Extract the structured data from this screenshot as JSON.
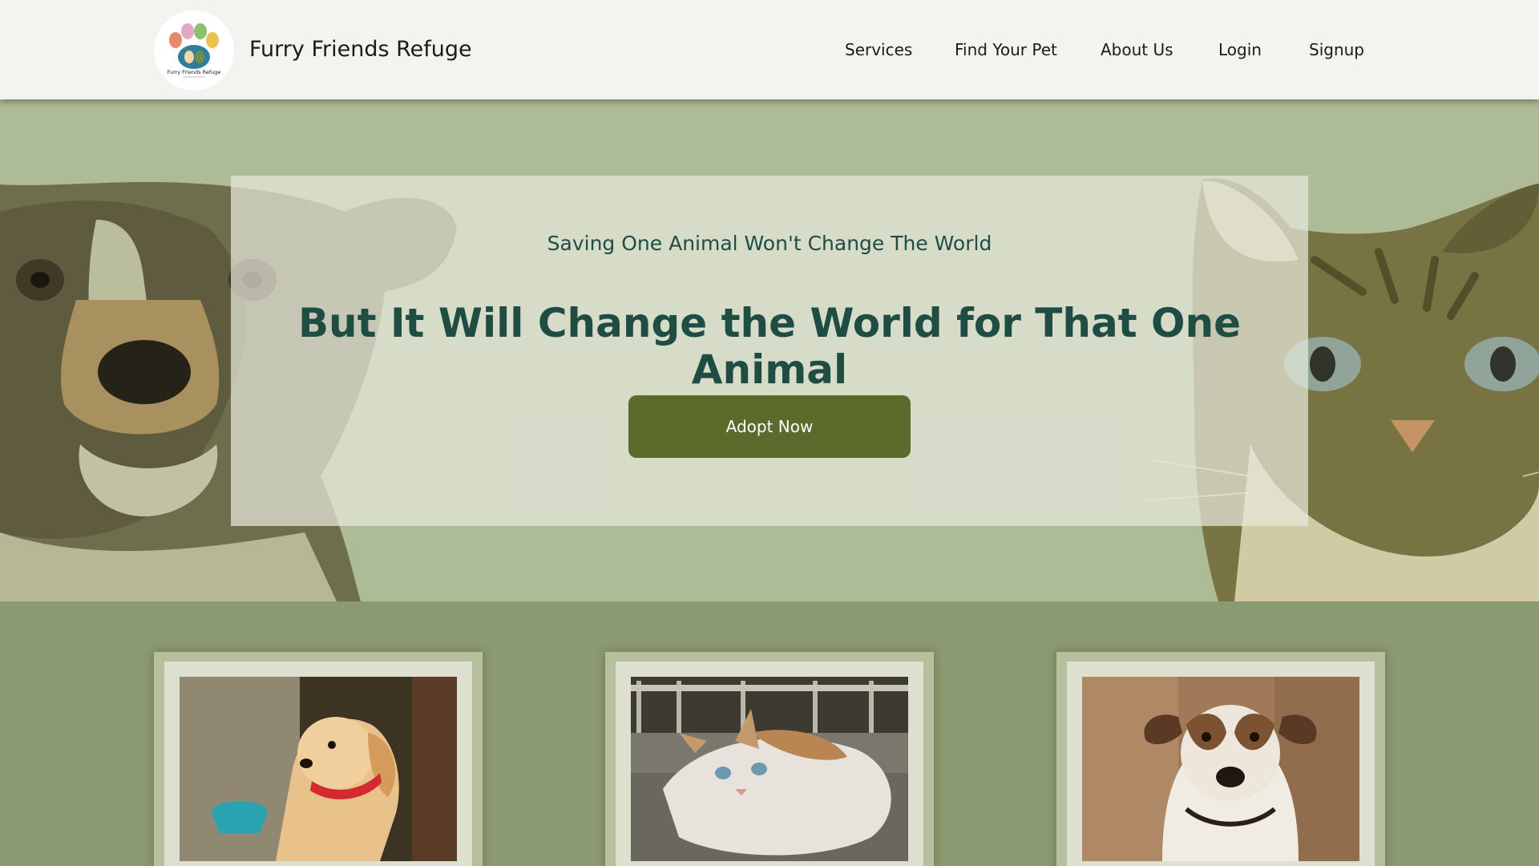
{
  "header": {
    "brand": "Furry Friends Refuge",
    "logo_text": "Furry Friends Refuge",
    "nav": [
      {
        "label": "Services"
      },
      {
        "label": "Find Your Pet"
      },
      {
        "label": "About Us"
      },
      {
        "label": "Login"
      },
      {
        "label": "Signup"
      }
    ]
  },
  "hero": {
    "subtitle": "Saving One Animal Won't Change The World",
    "title": "But It Will Change the World for That One Animal",
    "cta": "Adopt Now"
  },
  "cards": [
    {
      "image": "golden-puppy-photo"
    },
    {
      "image": "lying-cat-photo"
    },
    {
      "image": "terrier-dog-photo"
    }
  ],
  "colors": {
    "nav_bg": "#f2f4ef",
    "hero_bg": "#aebb97",
    "section_bg": "#8c9a71",
    "heading": "#1f4d44",
    "button": "#5b6b2c"
  }
}
